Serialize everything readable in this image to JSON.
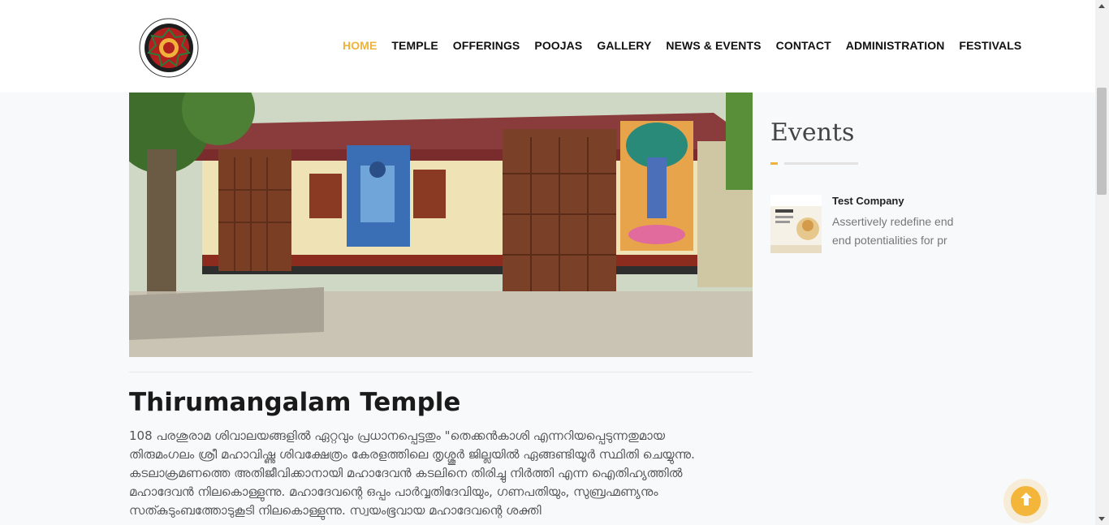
{
  "header": {
    "logo_alt": "Thirumangalam Mahadeva Temple",
    "nav": [
      {
        "label": "HOME",
        "active": true
      },
      {
        "label": "TEMPLE"
      },
      {
        "label": "OFFERINGS"
      },
      {
        "label": "POOJAS"
      },
      {
        "label": "GALLERY"
      },
      {
        "label": "NEWS & EVENTS"
      },
      {
        "label": "CONTACT"
      },
      {
        "label": "ADMINISTRATION"
      },
      {
        "label": "FESTIVALS"
      }
    ]
  },
  "main": {
    "title": "Thirumangalam Temple",
    "body": "108 പരശുരാമ ശിവാലയങ്ങളിൽ ഏറ്റവും പ്രധാനപ്പെട്ടതും \"തെക്കൻകാശി എന്നറിയപ്പെടുന്നതുമായ തിരുമംഗലം ശ്രീ മഹാവിഷ്ണു ശിവക്ഷേത്രം കേരളത്തിലെ തൃശ്ശൂർ ജില്ലയിൽ ഏങ്ങണ്ടിയൂർ സ്ഥിതി ചെയ്യുന്നു. കടലാക്രമണത്തെ അതിജീവിക്കാനായി മഹാദേവൻ കടലിനെ തിരിച്ചു നിർത്തി എന്ന ഐതിഹ്യത്തിൽ മഹാദേവൻ നിലകൊള്ളുന്നു. മഹാദേവന്റെ ഒപ്പം പാർവ്വതിദേവിയും, ഗണപതിയും, സുബ്രഹ്മണ്യനും സത്കുടുംബത്തോടുകൂടി നിലകൊള്ളുന്നു. സ്വയംഭൂവായ മഹാദേവന്റെ ശക്തി"
  },
  "sidebar": {
    "heading": "Events",
    "events": [
      {
        "name": "Test Company",
        "description": "Assertively redefine end end potentialities for pr"
      }
    ]
  },
  "colors": {
    "accent": "#f0b23a",
    "nav_text": "#111111",
    "background": "#f8f9fa"
  },
  "icons": {
    "back_to_top": "arrow-up-icon"
  }
}
